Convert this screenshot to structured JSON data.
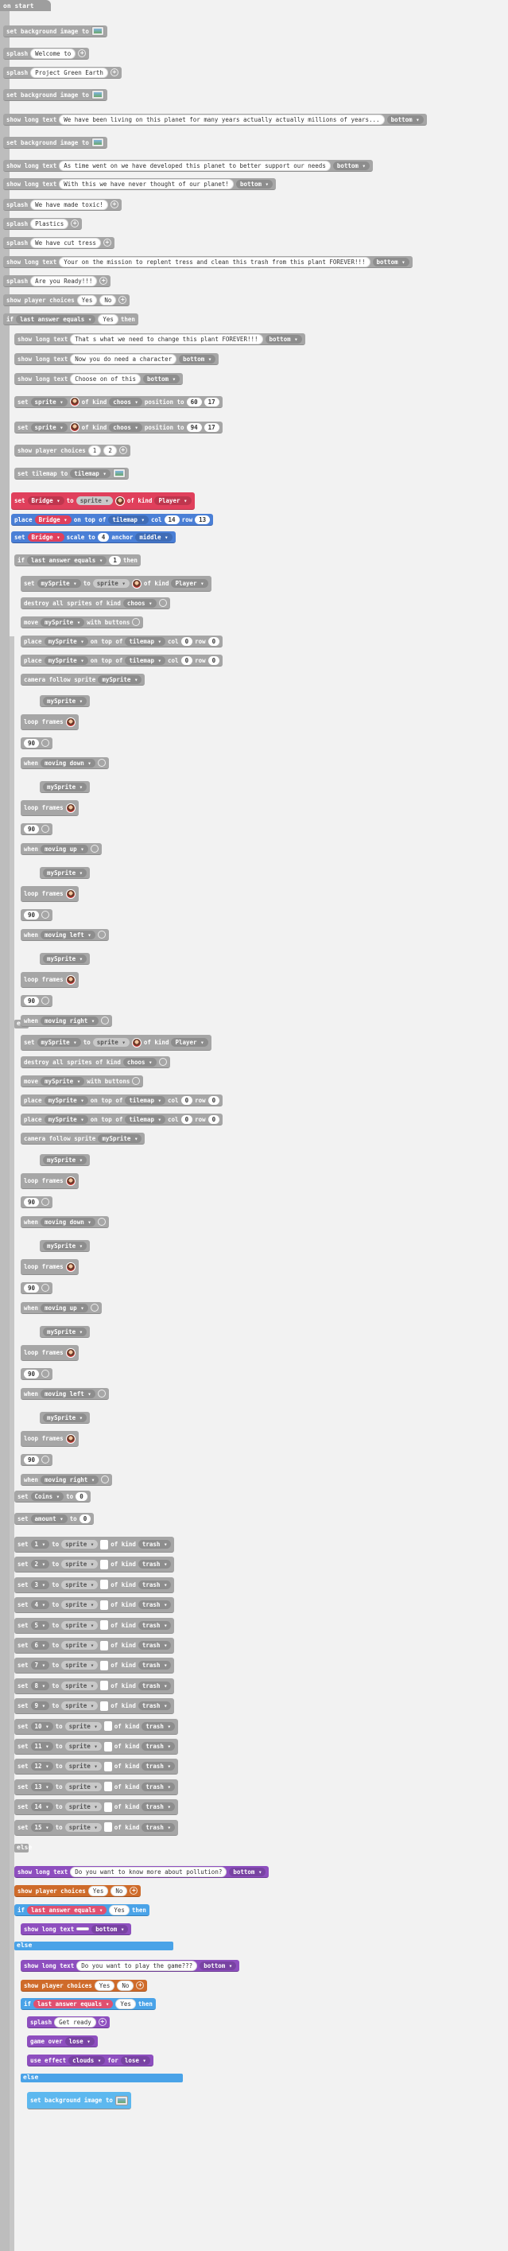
{
  "on_start": "on start",
  "labels": {
    "set_bg": "set background image to",
    "splash": "splash",
    "show_long": "show long text",
    "bottom": "bottom",
    "show_choices": "show player choices",
    "if": "if",
    "last_answer": "last answer equals",
    "then": "then",
    "else": "else",
    "set": "set",
    "to": "to",
    "sprite": "sprite",
    "of_kind": "of kind",
    "position_to": "position to",
    "set_tilemap": "set tilemap to",
    "tilemap": "tilemap",
    "place": "place",
    "on_top_of": "on top of",
    "col": "col",
    "row": "row",
    "scale_to": "scale to",
    "anchor": "anchor",
    "middle": "middle",
    "destroy_all": "destroy all sprites of kind",
    "move": "move",
    "with_buttons": "with buttons",
    "camera_follow": "camera follow sprite",
    "loop_frames": "loop frames",
    "when": "when",
    "moving_down": "moving down",
    "moving_up": "moving up",
    "moving_left": "moving left",
    "moving_right": "moving right",
    "game_over": "game over",
    "use_effect": "use effect",
    "clouds": "clouds",
    "for": "for"
  },
  "texts": {
    "welcome": "Welcome to",
    "project": "Project Green Earth",
    "long1": "We have been living on this planet for many years actually  actually millions of years...",
    "long2": "As time went on we have developed this planet to better support our needs",
    "long3": "With this we have never thought of our planet!",
    "toxic": "We have made toxic!",
    "plastics": "Plastics",
    "cut_tress": "We have cut tress",
    "long4": "Your on the mission to replent tress and clean this trash from this plant FOREVER!!!",
    "ready": "Are you Ready!!!",
    "yes": "Yes",
    "no": "No",
    "long5": "That s what we need to change this plant FOREVER!!!",
    "long6": "Now you do need a character",
    "long7": "Choose on of this",
    "choice1": "1",
    "choice2": "2",
    "pollution": "Do you want to know more about pollution?",
    "play_game": "Do you want to play the game???",
    "get_ready": "Get ready",
    "game_over_val": "lose",
    "effect_val": "lose"
  },
  "vars": {
    "choos": "choos",
    "player": "Player",
    "bridge": "Bridge",
    "mysprite": "mySprite",
    "trash": "trash",
    "coins": "Coins",
    "amount": "amount"
  },
  "numbers": {
    "x1": "60",
    "y1": "17",
    "x2": "94",
    "y2": "17",
    "col14": "14",
    "row13": "13",
    "scale4": "4",
    "one": "1",
    "zero": "0",
    "ninety": "90",
    "five": "5"
  },
  "trash_vars": [
    "1",
    "2",
    "3",
    "4",
    "5",
    "6",
    "7",
    "8",
    "9",
    "10",
    "11",
    "12",
    "13",
    "14",
    "15"
  ],
  "colors": {
    "red": "#e0405c",
    "blue": "#4a7fd6",
    "purple": "#8e4fbf",
    "orange": "#cf6b2a",
    "grey": "#a6a6a6"
  }
}
